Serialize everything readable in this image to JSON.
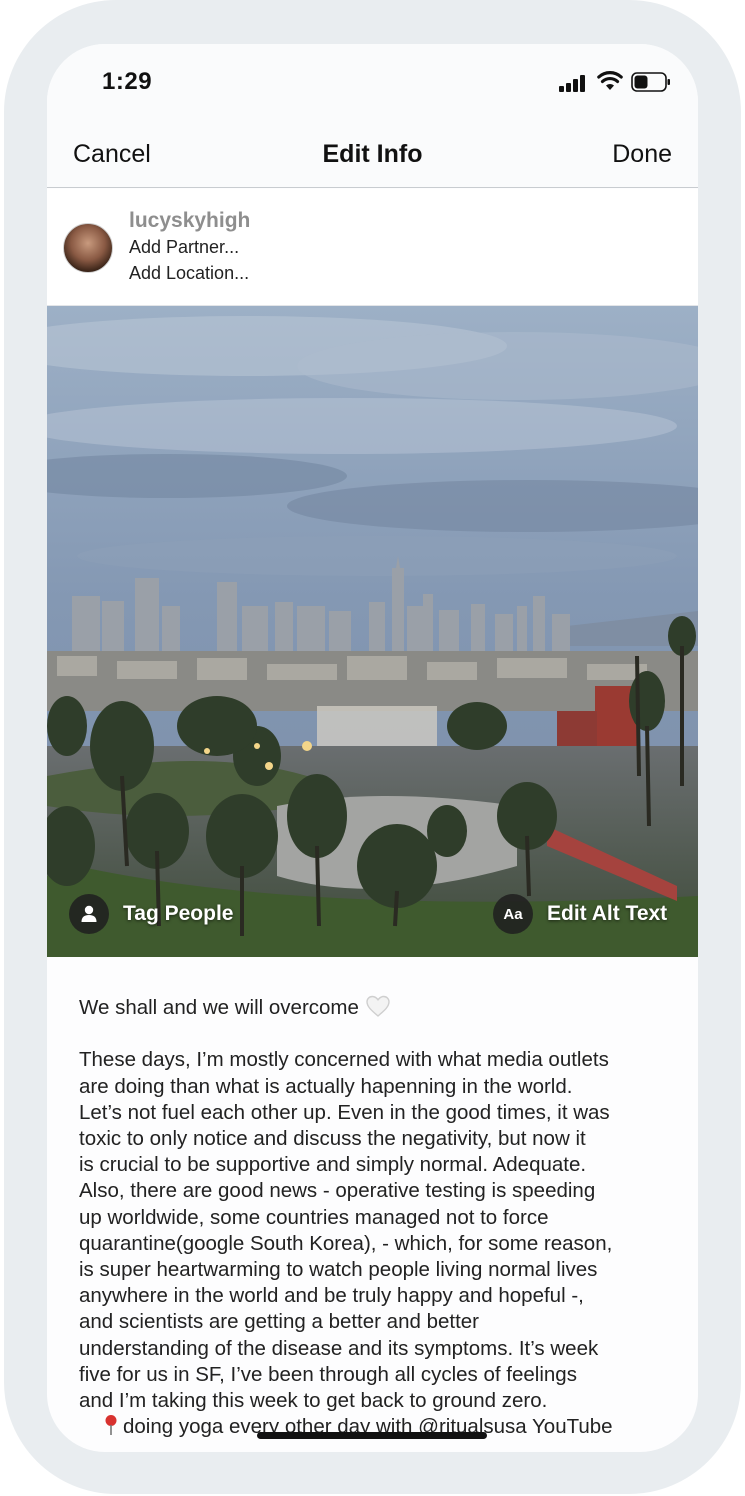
{
  "status_bar": {
    "time": "1:29"
  },
  "nav": {
    "cancel_label": "Cancel",
    "title": "Edit Info",
    "done_label": "Done"
  },
  "account": {
    "username": "lucyskyhigh",
    "add_partner_label": "Add Partner...",
    "add_location_label": "Add Location..."
  },
  "photo_actions": {
    "tag_people_label": "Tag People",
    "alt_text_badge": "Aa",
    "edit_alt_text_label": "Edit Alt Text"
  },
  "caption": {
    "first_line": "We shall and we will overcome",
    "lines": [
      "These days, I’m mostly concerned with what media outlets",
      "are doing than what is actually hapenning in the world.",
      "Let’s not fuel each other up. Even in the good times, it was",
      "toxic to only notice and discuss the negativity, but now it",
      "is crucial to be supportive and simply normal. Adequate.",
      "Also, there are good news - operative testing is speeding",
      "up worldwide, some countries managed not to force",
      "quarantine(google South Korea), - which, for some reason,",
      "is super heartwarming to watch people living normal lives",
      "anywhere in the world and be truly happy and hopeful -,",
      "and scientists are getting a better and better",
      "understanding of the disease and its symptoms. It’s week",
      "five for us in SF, I’ve been through all cycles of feelings",
      "and I’m taking this week to get back to ground zero."
    ],
    "last_line": "doing yoga every other day with @ritualsusa YouTube"
  },
  "icons": {
    "heart": "white-heart-icon",
    "pin": "round-pushpin-icon",
    "person": "person-icon"
  },
  "colors": {
    "accent_text": "#111111",
    "secondary_text": "#8e8e8e",
    "pin_red": "#d8322f"
  }
}
